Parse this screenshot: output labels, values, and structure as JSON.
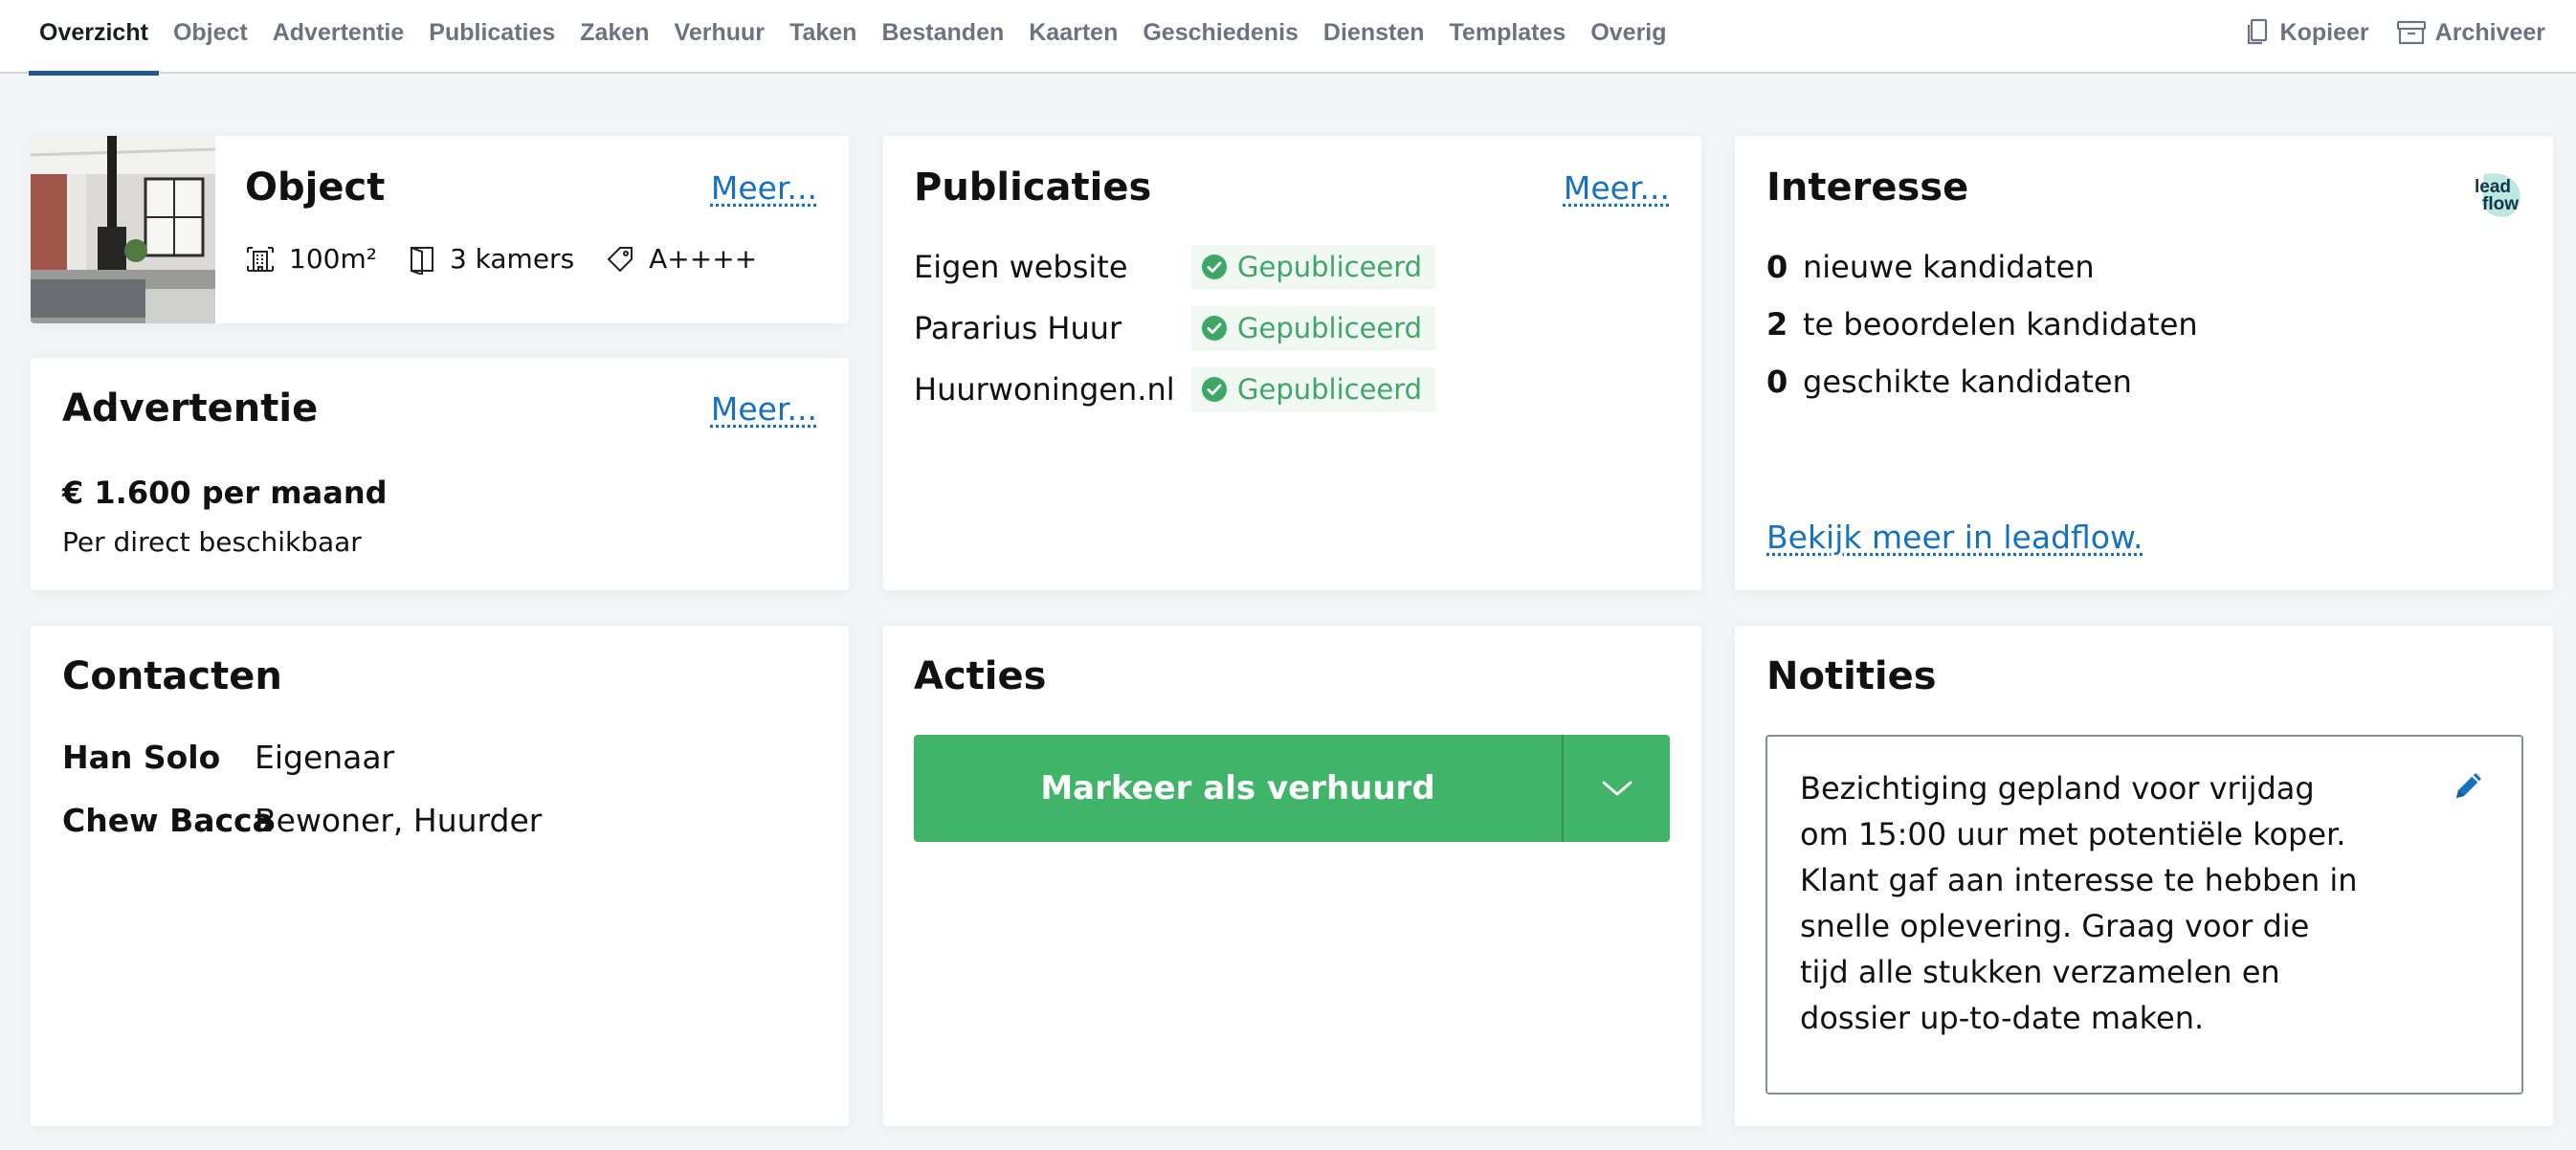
{
  "nav": {
    "tabs": [
      {
        "label": "Overzicht",
        "active": true
      },
      {
        "label": "Object"
      },
      {
        "label": "Advertentie"
      },
      {
        "label": "Publicaties"
      },
      {
        "label": "Zaken"
      },
      {
        "label": "Verhuur"
      },
      {
        "label": "Taken"
      },
      {
        "label": "Bestanden"
      },
      {
        "label": "Kaarten"
      },
      {
        "label": "Geschiedenis"
      },
      {
        "label": "Diensten"
      },
      {
        "label": "Templates"
      },
      {
        "label": "Overig"
      }
    ],
    "actions": {
      "copy_label": "Kopieer",
      "archive_label": "Archiveer"
    }
  },
  "object_card": {
    "title": "Object",
    "more": "Meer...",
    "area": "100m²",
    "rooms": "3 kamers",
    "energy_label": "A++++"
  },
  "advertentie_card": {
    "title": "Advertentie",
    "more": "Meer...",
    "price": "€ 1.600 per maand",
    "availability": "Per direct beschikbaar"
  },
  "publicaties_card": {
    "title": "Publicaties",
    "more": "Meer...",
    "items": [
      {
        "name": "Eigen website",
        "status": "Gepubliceerd"
      },
      {
        "name": "Pararius Huur",
        "status": "Gepubliceerd"
      },
      {
        "name": "Huurwoningen.nl",
        "status": "Gepubliceerd"
      }
    ]
  },
  "interesse_card": {
    "title": "Interesse",
    "logo_text": [
      "lead",
      "flow"
    ],
    "rows": [
      {
        "count": "0",
        "label": "nieuwe kandidaten"
      },
      {
        "count": "2",
        "label": "te beoordelen kandidaten"
      },
      {
        "count": "0",
        "label": "geschikte kandidaten"
      }
    ],
    "link": "Bekijk meer in leadflow."
  },
  "contacten_card": {
    "title": "Contacten",
    "contacts": [
      {
        "name": "Han Solo",
        "role": "Eigenaar"
      },
      {
        "name": "Chew Bacca",
        "role": "Bewoner, Huurder"
      }
    ]
  },
  "acties_card": {
    "title": "Acties",
    "primary_action": "Markeer als verhuurd"
  },
  "notities_card": {
    "title": "Notities",
    "note": "Bezichtiging gepland voor vrijdag om 15:00 uur met potentiële koper. Klant gaf aan interesse te hebben in snelle oplevering. Graag voor die tijd alle stukken verzamelen en dossier up-to-date maken."
  },
  "colors": {
    "accent_blue": "#1672c0",
    "active_tab_underline": "#23588e",
    "success_green": "#40b468",
    "published_green": "#3da865"
  }
}
